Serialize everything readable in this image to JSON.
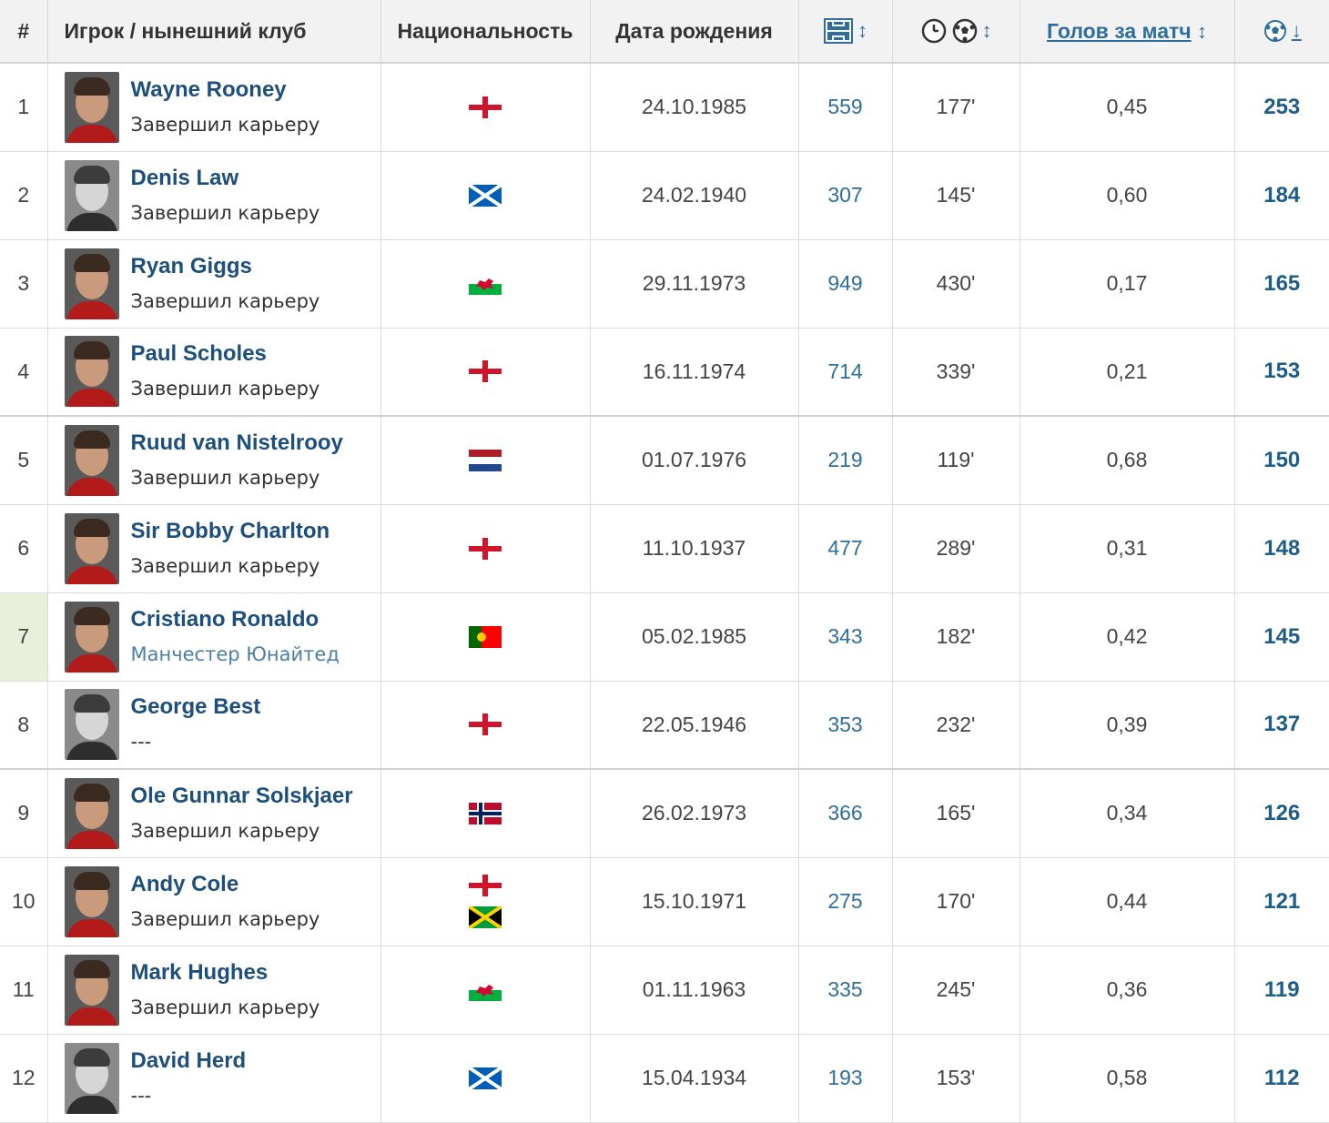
{
  "headers": {
    "rank": "#",
    "player": "Игрок / нынешний клуб",
    "nationality": "Национальность",
    "birth": "Дата рождения",
    "appearances_icon": "pitch-icon",
    "minutes_per_goal_icons": [
      "clock-icon",
      "ball-icon"
    ],
    "goals_per_match": "Голов за матч",
    "goals_icon": "goals-icon",
    "sort_both": "↕",
    "sort_down": "↓"
  },
  "players": [
    {
      "rank": "1",
      "name": "Wayne Rooney",
      "club": "Завершил карьеру",
      "flags": [
        "england"
      ],
      "birth": "24.10.1985",
      "apps": "559",
      "mpg": "177'",
      "gpm": "0,45",
      "goals": "253",
      "photo": "color"
    },
    {
      "rank": "2",
      "name": "Denis Law",
      "club": "Завершил карьеру",
      "flags": [
        "scotland"
      ],
      "birth": "24.02.1940",
      "apps": "307",
      "mpg": "145'",
      "gpm": "0,60",
      "goals": "184",
      "photo": "bw"
    },
    {
      "rank": "3",
      "name": "Ryan Giggs",
      "club": "Завершил карьеру",
      "flags": [
        "wales"
      ],
      "birth": "29.11.1973",
      "apps": "949",
      "mpg": "430'",
      "gpm": "0,17",
      "goals": "165",
      "photo": "color"
    },
    {
      "rank": "4",
      "name": "Paul Scholes",
      "club": "Завершил карьеру",
      "flags": [
        "england"
      ],
      "birth": "16.11.1974",
      "apps": "714",
      "mpg": "339'",
      "gpm": "0,21",
      "goals": "153",
      "photo": "color"
    },
    {
      "rank": "5",
      "name": "Ruud van Nistelrooy",
      "club": "Завершил карьеру",
      "flags": [
        "netherlands"
      ],
      "birth": "01.07.1976",
      "apps": "219",
      "mpg": "119'",
      "gpm": "0,68",
      "goals": "150",
      "photo": "color"
    },
    {
      "rank": "6",
      "name": "Sir Bobby Charlton",
      "club": "Завершил карьеру",
      "flags": [
        "england"
      ],
      "birth": "11.10.1937",
      "apps": "477",
      "mpg": "289'",
      "gpm": "0,31",
      "goals": "148",
      "photo": "color"
    },
    {
      "rank": "7",
      "name": "Cristiano Ronaldo",
      "club": "Манчестер Юнайтед",
      "club_link": true,
      "flags": [
        "portugal"
      ],
      "birth": "05.02.1985",
      "apps": "343",
      "mpg": "182'",
      "gpm": "0,42",
      "goals": "145",
      "photo": "color",
      "highlight": true
    },
    {
      "rank": "8",
      "name": "George Best",
      "club": "---",
      "flags": [
        "england"
      ],
      "birth": "22.05.1946",
      "apps": "353",
      "mpg": "232'",
      "gpm": "0,39",
      "goals": "137",
      "photo": "bw"
    },
    {
      "rank": "9",
      "name": "Ole Gunnar Solskjaer",
      "club": "Завершил карьеру",
      "flags": [
        "norway"
      ],
      "birth": "26.02.1973",
      "apps": "366",
      "mpg": "165'",
      "gpm": "0,34",
      "goals": "126",
      "photo": "color"
    },
    {
      "rank": "10",
      "name": "Andy Cole",
      "club": "Завершил карьеру",
      "flags": [
        "england",
        "jamaica"
      ],
      "birth": "15.10.1971",
      "apps": "275",
      "mpg": "170'",
      "gpm": "0,44",
      "goals": "121",
      "photo": "color"
    },
    {
      "rank": "11",
      "name": "Mark Hughes",
      "club": "Завершил карьеру",
      "flags": [
        "wales"
      ],
      "birth": "01.11.1963",
      "apps": "335",
      "mpg": "245'",
      "gpm": "0,36",
      "goals": "119",
      "photo": "color"
    },
    {
      "rank": "12",
      "name": "David Herd",
      "club": "---",
      "flags": [
        "scotland"
      ],
      "birth": "15.04.1934",
      "apps": "193",
      "mpg": "153'",
      "gpm": "0,58",
      "goals": "112",
      "photo": "bw"
    }
  ],
  "colors": {
    "link": "#1d4f7c",
    "number_link": "#2f6e9c",
    "highlight_rank_bg": "#e8f0d9",
    "header_bg": "#f2f2f2"
  }
}
